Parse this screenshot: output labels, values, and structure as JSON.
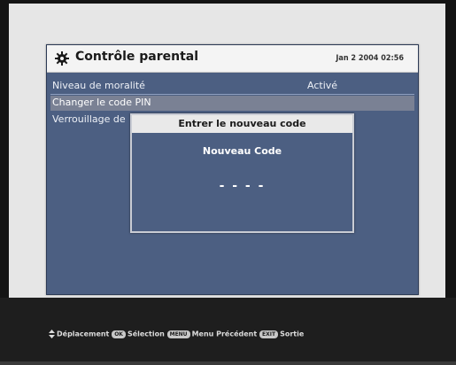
{
  "menu": {
    "title": "Contrôle parental",
    "datetime": "Jan 2 2004 02:56",
    "icon": "gear-icon",
    "items": [
      {
        "label": "Niveau de moralité",
        "value": "Activé"
      },
      {
        "label": "Changer le code PIN",
        "value": ""
      },
      {
        "label": "Verrouillage de",
        "value": ""
      }
    ]
  },
  "dialog": {
    "title": "Entrer le nouveau code",
    "field_label": "Nouveau Code",
    "code_placeholder": "- - - -"
  },
  "footer": {
    "move_label": "Déplacement",
    "ok_key": "OK",
    "select_label": "Sélection",
    "menu_key": "MENU",
    "menu_label": "Menu Précédent",
    "exit_key": "EXIT",
    "exit_label": "Sortie"
  },
  "colors": {
    "menu_bg": "#4c5f82",
    "header_bg": "#f4f4f4",
    "selected_row": "#7a8194",
    "footer_bg": "#1e1e1e"
  }
}
